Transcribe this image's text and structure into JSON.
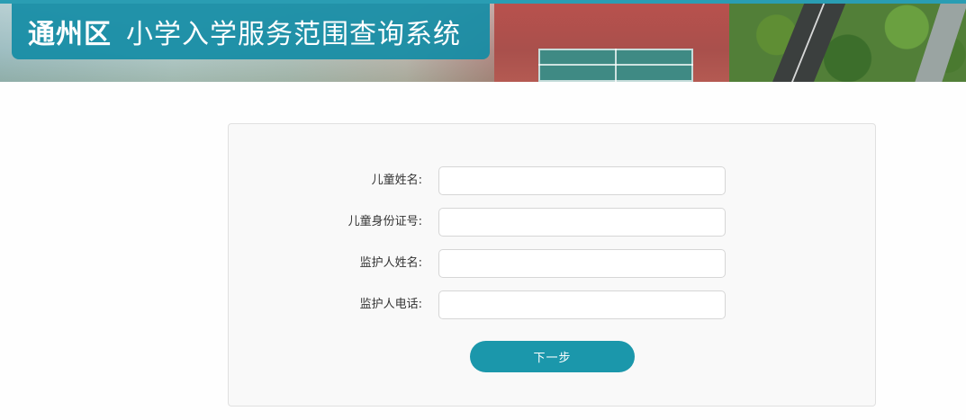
{
  "header": {
    "district": "通州区",
    "system_title": "小学入学服务范围查询系统"
  },
  "form": {
    "fields": [
      {
        "label": "儿童姓名:",
        "value": "",
        "placeholder": ""
      },
      {
        "label": "儿童身份证号:",
        "value": "",
        "placeholder": ""
      },
      {
        "label": "监护人姓名:",
        "value": "",
        "placeholder": ""
      },
      {
        "label": "监护人电话:",
        "value": "",
        "placeholder": ""
      }
    ],
    "next_label": "下一步"
  },
  "colors": {
    "accent": "#1b97ab",
    "title_plate": "#148ca5",
    "panel_bg": "#f9f9f9"
  }
}
